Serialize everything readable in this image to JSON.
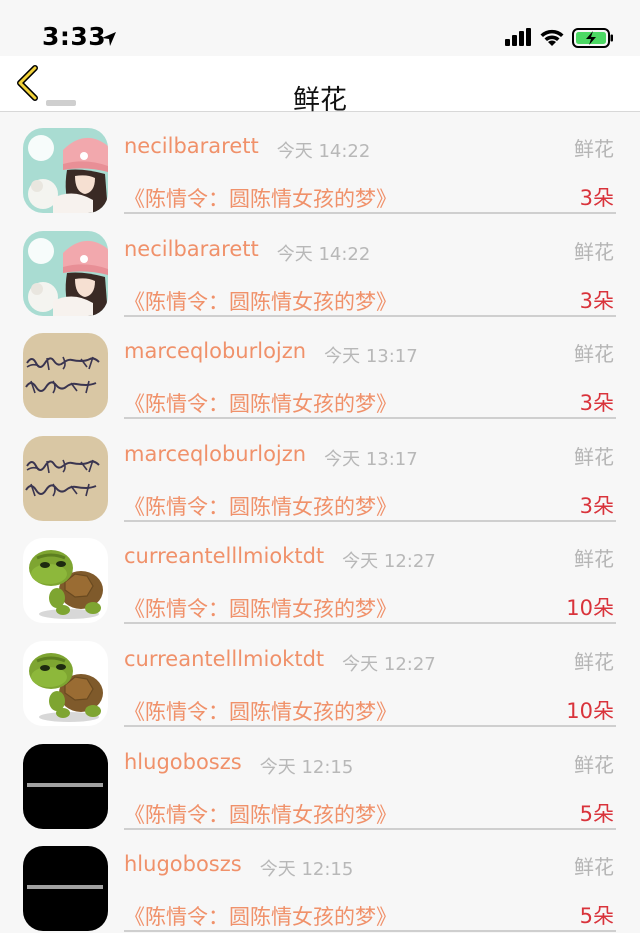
{
  "status": {
    "time": "3:33"
  },
  "nav": {
    "title": "鲜花"
  },
  "rows": [
    {
      "avatar": "girl-hat-photo",
      "user": "necilbararett",
      "time": "今天 14:22",
      "gift": "鲜花",
      "song": "《陈情令：圆陈情女孩的梦》",
      "count": "3朵"
    },
    {
      "avatar": "girl-hat-photo",
      "user": "necilbararett",
      "time": "今天 14:22",
      "gift": "鲜花",
      "song": "《陈情令：圆陈情女孩的梦》",
      "count": "3朵"
    },
    {
      "avatar": "handwriting-photo",
      "user": "marceqloburlojzn",
      "time": "今天 13:17",
      "gift": "鲜花",
      "song": "《陈情令：圆陈情女孩的梦》",
      "count": "3朵"
    },
    {
      "avatar": "handwriting-photo",
      "user": "marceqloburlojzn",
      "time": "今天 13:17",
      "gift": "鲜花",
      "song": "《陈情令：圆陈情女孩的梦》",
      "count": "3朵"
    },
    {
      "avatar": "turtle-photo",
      "user": "curreantelllmioktdt",
      "time": "今天 12:27",
      "gift": "鲜花",
      "song": "《陈情令：圆陈情女孩的梦》",
      "count": "10朵"
    },
    {
      "avatar": "turtle-photo",
      "user": "curreantelllmioktdt",
      "time": "今天 12:27",
      "gift": "鲜花",
      "song": "《陈情令：圆陈情女孩的梦》",
      "count": "10朵"
    },
    {
      "avatar": "black-text-photo",
      "user": "hlugoboszs",
      "time": "今天 12:15",
      "gift": "鲜花",
      "song": "《陈情令：圆陈情女孩的梦》",
      "count": "5朵"
    },
    {
      "avatar": "black-text-photo",
      "user": "hlugoboszs",
      "time": "今天 12:15",
      "gift": "鲜花",
      "song": "《陈情令：圆陈情女孩的梦》",
      "count": "5朵"
    }
  ],
  "colors": {
    "username": "#f0916a",
    "count": "#d9333b",
    "muted": "#b8b8b8",
    "battery": "#4cd964",
    "back_arrow": "#f2d23a"
  }
}
